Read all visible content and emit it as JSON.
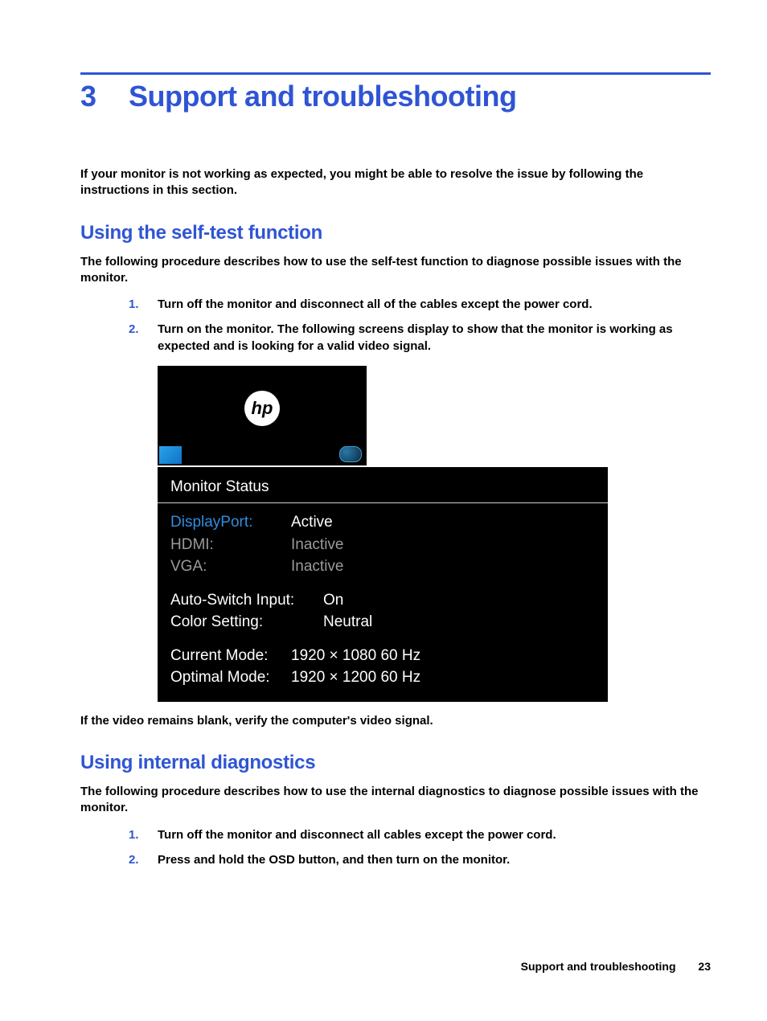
{
  "chapter": {
    "number": "3",
    "title": "Support and troubleshooting"
  },
  "intro": "If your monitor is not working as expected, you might be able to resolve the issue by following the instructions in this section.",
  "section1": {
    "heading": "Using the self-test function",
    "desc": "The following procedure describes how to use the self-test function to diagnose possible issues with the monitor.",
    "step1": "Turn off the monitor and disconnect all of the cables except the power cord.",
    "step2": "Turn on the monitor. The following screens display to show that the monitor is working as expected and is looking for a valid video signal.",
    "after": "If the video remains blank, verify the computer's video signal."
  },
  "osd": {
    "logo_text": "hp",
    "title": "Monitor Status",
    "inputs": {
      "displayport_label": "DisplayPort:",
      "displayport_value": "Active",
      "hdmi_label": "HDMI:",
      "hdmi_value": "Inactive",
      "vga_label": "VGA:",
      "vga_value": "Inactive"
    },
    "settings": {
      "autoswitch_label": "Auto-Switch Input:",
      "autoswitch_value": "On",
      "color_label": "Color Setting:",
      "color_value": "Neutral"
    },
    "modes": {
      "current_label": "Current Mode:",
      "current_value": "1920 × 1080  60 Hz",
      "optimal_label": "Optimal Mode:",
      "optimal_value": "1920 × 1200  60 Hz"
    }
  },
  "section2": {
    "heading": "Using internal diagnostics",
    "desc": "The following procedure describes how to use the internal diagnostics to diagnose possible issues with the monitor.",
    "step1": "Turn off the monitor and disconnect all cables except the power cord.",
    "step2": "Press and hold the OSD button, and then turn on the monitor."
  },
  "footer": {
    "section": "Support and troubleshooting",
    "page": "23"
  }
}
